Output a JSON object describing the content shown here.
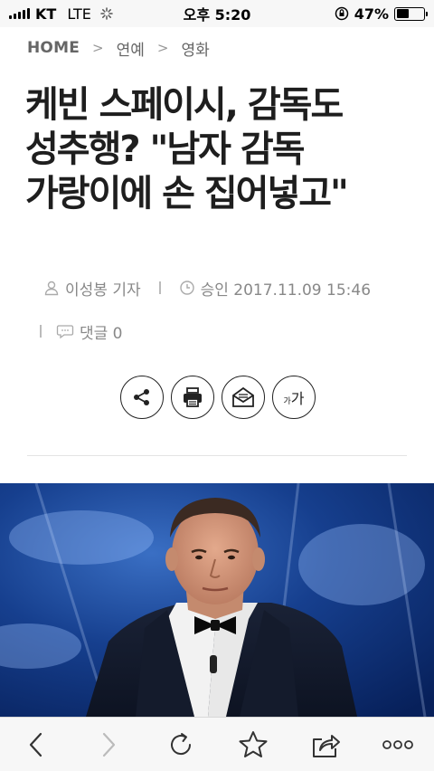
{
  "status_bar": {
    "carrier": "KT",
    "network": "LTE",
    "time": "오후 5:20",
    "battery_percent": "47%",
    "battery_level": 0.47
  },
  "breadcrumb": {
    "items": [
      "HOME",
      "연예",
      "영화"
    ]
  },
  "article": {
    "title_lines": [
      "케빈 스페이시, 감독도",
      "성추행? \"남자 감독",
      "가랑이에 손 집어넣고\""
    ],
    "reporter": "이성봉 기자",
    "approved": "승인 2017.11.09 15:46",
    "comments": "댓글 0"
  },
  "tools": {
    "icons": [
      "share-icon",
      "print-icon",
      "email-icon",
      "font-size-icon"
    ],
    "font_size_label_small": "가",
    "font_size_label_large": "가"
  },
  "colors": {
    "status_bg": "#f7f7f7",
    "meta_gray": "#888888",
    "photo_bg": "#0b2a66"
  },
  "bottom_bar": {
    "icons": [
      "back-icon",
      "forward-icon",
      "reload-icon",
      "bookmark-star-icon",
      "share-out-icon",
      "more-icon"
    ]
  }
}
